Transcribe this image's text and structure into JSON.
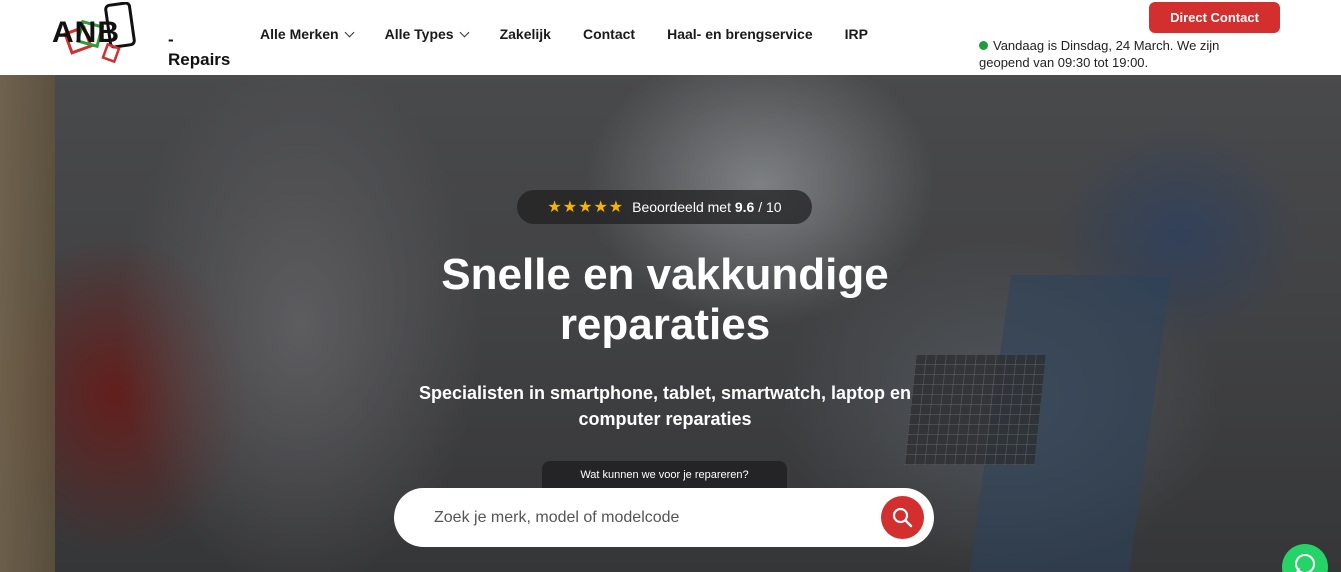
{
  "brand": {
    "logo_letters": "ANB",
    "logo_suffix": "-Repairs"
  },
  "nav": {
    "items": [
      {
        "label": "Alle Merken",
        "dropdown": true
      },
      {
        "label": "Alle Types",
        "dropdown": true
      },
      {
        "label": "Zakelijk",
        "dropdown": false
      },
      {
        "label": "Contact",
        "dropdown": false
      },
      {
        "label": "Haal- en brengservice",
        "dropdown": false
      },
      {
        "label": "IRP",
        "dropdown": false
      }
    ]
  },
  "header": {
    "cta_label": "Direct Contact",
    "status_text": "Vandaag is Dinsdag, 24 March. We zijn geopend van 09:30 tot 19:00."
  },
  "hero": {
    "rating_stars": "★★★★★",
    "rating_prefix": "Beoordeeld met",
    "rating_value": "9.6",
    "rating_suffix": "/ 10",
    "title": "Snelle en vakkundige reparaties",
    "subtitle": "Specialisten in smartphone, tablet, smartwatch, laptop en computer reparaties",
    "search_label": "Wat kunnen we voor je repareren?",
    "search_placeholder": "Zoek je merk, model of modelcode"
  },
  "colors": {
    "accent": "#d32f2f",
    "open_status": "#1e9e3a",
    "star": "#f5b400",
    "whatsapp": "#25d366"
  },
  "icons": {
    "search": "search-icon",
    "whatsapp": "whatsapp-icon",
    "chevron": "chevron-down-icon"
  }
}
